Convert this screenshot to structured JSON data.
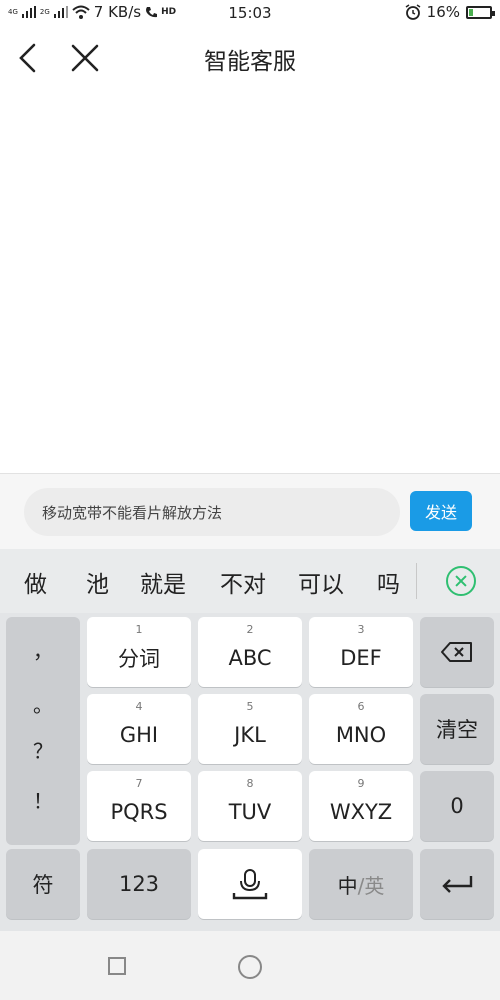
{
  "status_bar": {
    "net_4g": "4G",
    "net_2g": "2G",
    "speed": "7 KB/s",
    "hd": "HD",
    "time": "15:03",
    "battery": "16%",
    "battery_level": 0.16
  },
  "header": {
    "title": "智能客服"
  },
  "input_bar": {
    "text": "移动宽带不能看片解放方法",
    "send_label": "发送"
  },
  "candidates": [
    "做",
    "池",
    "就是",
    "不对",
    "可以",
    "吗"
  ],
  "keyboard": {
    "punctuation": [
      "，",
      "。",
      "？",
      "！"
    ],
    "keys": [
      {
        "num": "1",
        "label": "分词"
      },
      {
        "num": "2",
        "label": "ABC"
      },
      {
        "num": "3",
        "label": "DEF"
      },
      {
        "num": "4",
        "label": "GHI"
      },
      {
        "num": "5",
        "label": "JKL"
      },
      {
        "num": "6",
        "label": "MNO"
      },
      {
        "num": "7",
        "label": "PQRS"
      },
      {
        "num": "8",
        "label": "TUV"
      },
      {
        "num": "9",
        "label": "WXYZ"
      }
    ],
    "clear_label": "清空",
    "zero_label": "0",
    "symbol_label": "符",
    "numeric_label": "123",
    "lang_cn": "中",
    "lang_sep": "/",
    "lang_en": "英"
  },
  "colors": {
    "send_button": "#1a9be6",
    "candidate_close": "#2fbf71"
  }
}
